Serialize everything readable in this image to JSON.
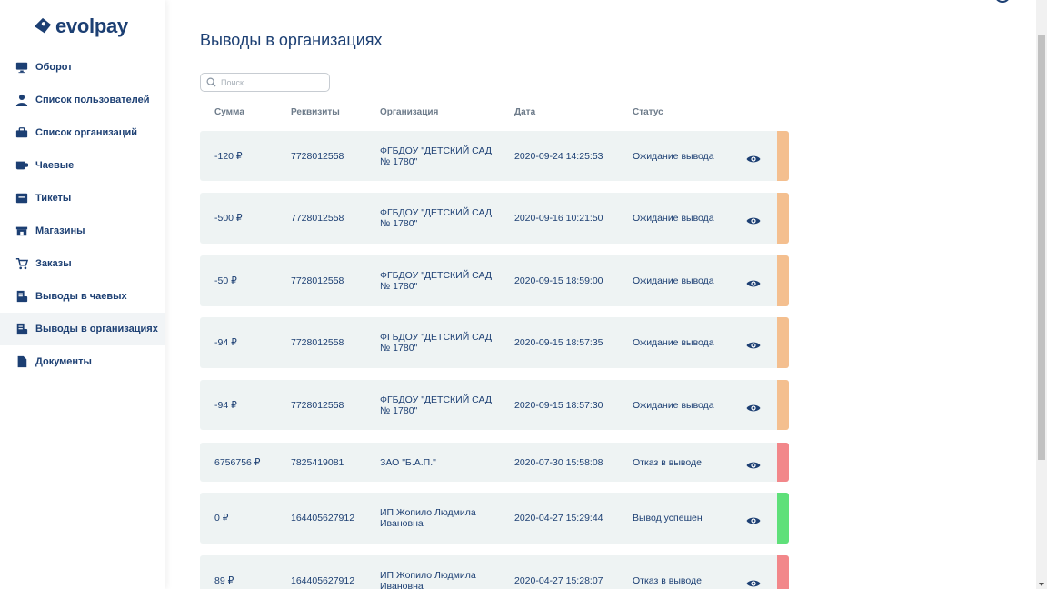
{
  "brand": {
    "name": "evolpay",
    "color": "#1c3f73"
  },
  "sidebar": {
    "items": [
      {
        "label": "Оборот",
        "icon": "monitor-chart-icon",
        "active": false
      },
      {
        "label": "Список пользователей",
        "icon": "user-icon",
        "active": false
      },
      {
        "label": "Список организаций",
        "icon": "briefcase-icon",
        "active": false
      },
      {
        "label": "Чаевые",
        "icon": "coffee-cup-icon",
        "active": false
      },
      {
        "label": "Тикеты",
        "icon": "ticket-icon",
        "active": false
      },
      {
        "label": "Магазины",
        "icon": "store-icon",
        "active": false
      },
      {
        "label": "Заказы",
        "icon": "cart-icon",
        "active": false
      },
      {
        "label": "Выводы в чаевых",
        "icon": "receipt-icon",
        "active": false
      },
      {
        "label": "Выводы в организациях",
        "icon": "receipt-icon",
        "active": true
      },
      {
        "label": "Документы",
        "icon": "document-icon",
        "active": false
      }
    ]
  },
  "main": {
    "title": "Выводы в организациях",
    "search": {
      "placeholder": "Поиск",
      "value": ""
    },
    "columns": [
      "Сумма",
      "Реквизиты",
      "Организация",
      "Дата",
      "Статус"
    ],
    "status_colors": {
      "pending": "#f4bf8f",
      "rejected": "#f2878a",
      "success": "#5fe07a"
    },
    "rows": [
      {
        "amount": "-120 ₽",
        "requisites": "7728012558",
        "organization": "ФГБДОУ \"ДЕТСКИЙ САД № 1780\"",
        "date": "2020-09-24 14:25:53",
        "status": "Ожидание вывода",
        "status_type": "pending"
      },
      {
        "amount": "-500 ₽",
        "requisites": "7728012558",
        "organization": "ФГБДОУ \"ДЕТСКИЙ САД № 1780\"",
        "date": "2020-09-16 10:21:50",
        "status": "Ожидание вывода",
        "status_type": "pending"
      },
      {
        "amount": "-50 ₽",
        "requisites": "7728012558",
        "organization": "ФГБДОУ \"ДЕТСКИЙ САД № 1780\"",
        "date": "2020-09-15 18:59:00",
        "status": "Ожидание вывода",
        "status_type": "pending"
      },
      {
        "amount": "-94 ₽",
        "requisites": "7728012558",
        "organization": "ФГБДОУ \"ДЕТСКИЙ САД № 1780\"",
        "date": "2020-09-15 18:57:35",
        "status": "Ожидание вывода",
        "status_type": "pending"
      },
      {
        "amount": "-94 ₽",
        "requisites": "7728012558",
        "organization": "ФГБДОУ \"ДЕТСКИЙ САД № 1780\"",
        "date": "2020-09-15 18:57:30",
        "status": "Ожидание вывода",
        "status_type": "pending"
      },
      {
        "amount": "6756756 ₽",
        "requisites": "7825419081",
        "organization": "ЗАО \"Б.А.П.\"",
        "date": "2020-07-30 15:58:08",
        "status": "Отказ в выводе",
        "status_type": "rejected"
      },
      {
        "amount": "0 ₽",
        "requisites": "164405627912",
        "organization": "ИП Жопило Людмила Ивановна",
        "date": "2020-04-27 15:29:44",
        "status": "Вывод успешен",
        "status_type": "success"
      },
      {
        "amount": "89 ₽",
        "requisites": "164405627912",
        "organization": "ИП Жопило Людмила Ивановна",
        "date": "2020-04-27 15:28:07",
        "status": "Отказ в выводе",
        "status_type": "rejected"
      }
    ]
  }
}
